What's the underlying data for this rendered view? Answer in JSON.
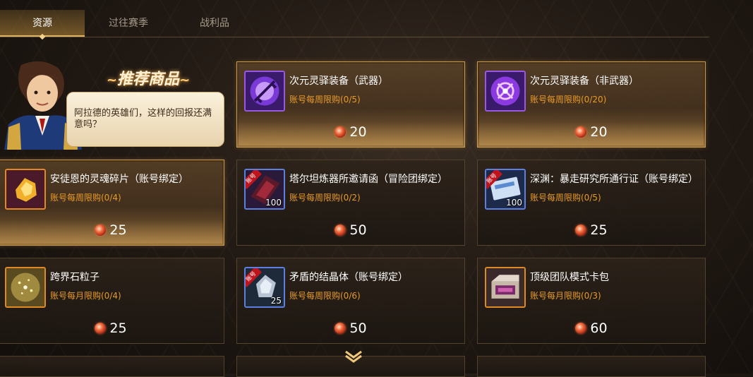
{
  "tabs": [
    {
      "label": "资源",
      "active": true
    },
    {
      "label": "过往赛季",
      "active": false
    },
    {
      "label": "战利品",
      "active": false
    }
  ],
  "recommend": {
    "title": "推荐商品",
    "npc_dialog": "阿拉德的英雄们，这样的回报还满意吗？"
  },
  "items": [
    {
      "name": "次元灵驿装备（武器）",
      "limit": "账号每周限购(0/5)",
      "price": "20",
      "icon": "dimension-weapon-icon",
      "rarity": "purple",
      "featured": true
    },
    {
      "name": "次元灵驿装备（非武器）",
      "limit": "账号每周限购(0/20)",
      "price": "20",
      "icon": "dimension-armor-icon",
      "rarity": "purple",
      "featured": true
    },
    {
      "name": "安徒恩的灵魂碎片（账号绑定）",
      "limit": "账号每周限购(0/4)",
      "price": "25",
      "icon": "soul-fragment-icon",
      "rarity": "orange",
      "featured": true
    },
    {
      "name": "塔尔坦炼器所邀请函（冒险团绑定）",
      "limit": "账号每周限购(0/2)",
      "price": "50",
      "icon": "invitation-icon",
      "rarity": "blue",
      "quantity": "100",
      "tag": "账号",
      "featured": false
    },
    {
      "name": "深渊：暴走研究所通行证（账号绑定）",
      "limit": "账号每周限购(0/5)",
      "price": "25",
      "icon": "pass-ticket-icon",
      "rarity": "blue",
      "quantity": "100",
      "tag": "账号",
      "featured": false
    },
    {
      "name": "跨界石粒子",
      "limit": "账号每月限购(0/4)",
      "price": "25",
      "icon": "crossover-particle-icon",
      "rarity": "orange",
      "featured": false
    },
    {
      "name": "矛盾的结晶体（账号绑定）",
      "limit": "账号每周限购(0/6)",
      "price": "50",
      "icon": "crystal-icon",
      "rarity": "blue",
      "quantity": "25",
      "tag": "账号",
      "featured": false
    },
    {
      "name": "顶级团队模式卡包",
      "limit": "账号每月限购(0/3)",
      "price": "60",
      "icon": "card-pack-icon",
      "rarity": "orange",
      "featured": false
    }
  ],
  "colors": {
    "limit_text": "#e89a28",
    "gold_border": "#c79a52",
    "purple_rarity": "#9a58e0",
    "orange_rarity": "#e08a26",
    "blue_rarity": "#5d7fe0"
  }
}
